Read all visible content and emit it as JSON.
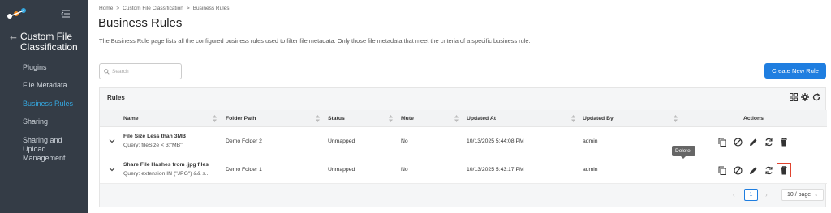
{
  "sidebar": {
    "section_title": "Custom File Classification",
    "items": [
      {
        "label": "Plugins",
        "active": false
      },
      {
        "label": "File Metadata",
        "active": false
      },
      {
        "label": "Business Rules",
        "active": true
      },
      {
        "label": "Sharing",
        "active": false
      },
      {
        "label": "Sharing and Upload Management",
        "active": false
      }
    ]
  },
  "breadcrumb": [
    "Home",
    "Custom File Classification",
    "Business Rules"
  ],
  "breadcrumb_separator": ">",
  "page": {
    "title": "Business Rules",
    "description": "The Business Rule page lists all the configured business rules used to filter file metadata. Only those file metadata that meet the criteria of a specific business rule."
  },
  "search": {
    "placeholder": "Search"
  },
  "create_button": "Create New Rule",
  "panel": {
    "title": "Rules"
  },
  "table": {
    "columns": [
      "Name",
      "Folder Path",
      "Status",
      "Mute",
      "Updated At",
      "Updated By",
      "Actions"
    ],
    "rows": [
      {
        "name": "File Size Less than 3MB",
        "query": "Query: fileSize < 3:\"MB\"",
        "folder": "Demo Folder 2",
        "status": "Unmapped",
        "mute": "No",
        "updated_at": "10/13/2025 5:44:08 PM",
        "updated_by": "admin"
      },
      {
        "name": "Share File Hashes from .jpg files",
        "query": "Query: extension IN (\"JPG\") && s...",
        "folder": "Demo Folder 1",
        "status": "Unmapped",
        "mute": "No",
        "updated_at": "10/13/2025 5:43:17 PM",
        "updated_by": "admin"
      }
    ]
  },
  "tooltip": "Delete.",
  "pagination": {
    "current_page": "1",
    "page_size": "10 / page"
  },
  "colors": {
    "sidebar_bg": "#343c46",
    "accent": "#1f7ee0",
    "active_nav": "#35a8e0",
    "highlight": "#e0432f"
  }
}
